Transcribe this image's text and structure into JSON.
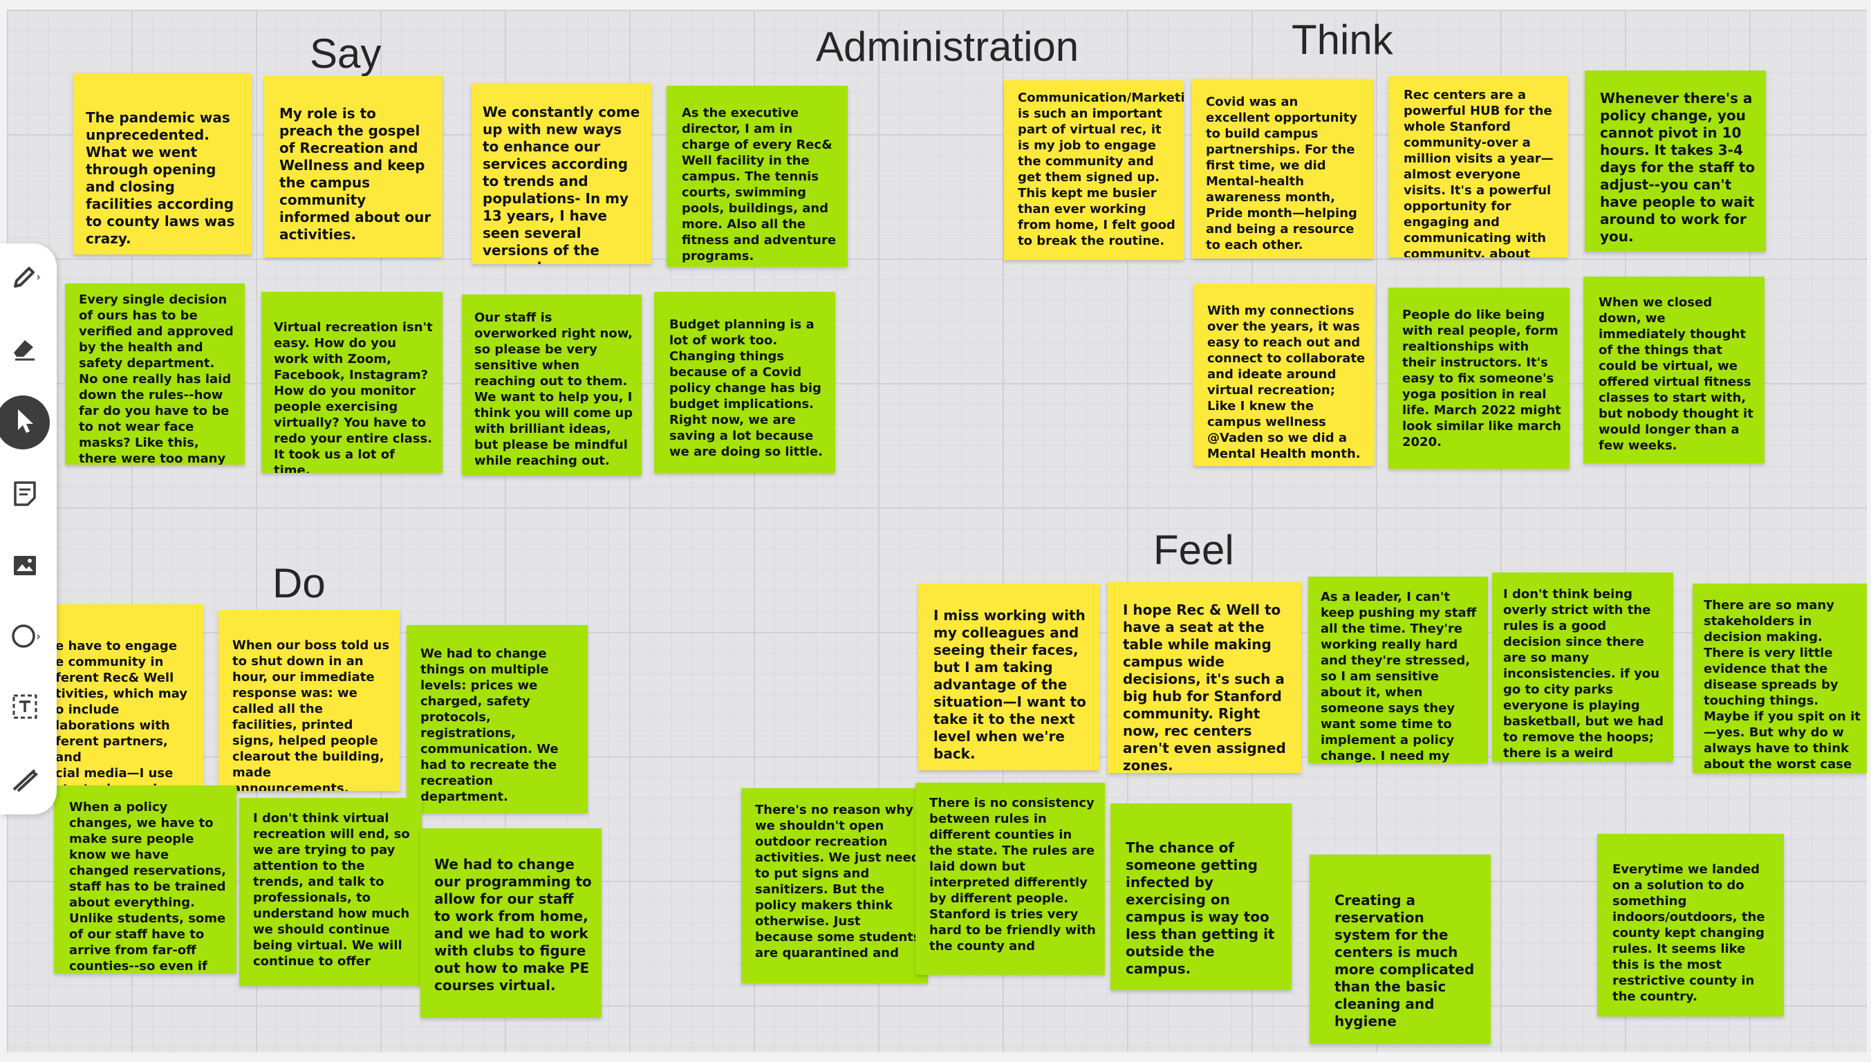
{
  "board": {
    "headings": {
      "say": "Say",
      "administration": "Administration",
      "think": "Think",
      "do": "Do",
      "feel": "Feel"
    },
    "notes": {
      "say_1": "The pandemic was unprecedented. What we went through opening and closing facilities according to county laws was crazy.",
      "say_2": "My role is to preach the gospel of Recreation and Wellness and keep the campus community informed about our activities.",
      "say_3": "We constantly come up with new ways to enhance our services according to trends and populations- In my 13 years, I have seen several versions of the same classes.",
      "say_4": "As the executive director, I am in charge of every Rec& Well facility in the campus. The tennis courts, swimming pools, buildings, and more. Also all the fitness and adventure programs.",
      "say_5": "Every single decision of ours has to be verified and approved by the health and safety department. No one really has laid down the rules--how far do you have to be to not wear face masks? Like this, there were too many",
      "say_6": "Virtual recreation isn't easy. How do you work with Zoom, Facebook, Instagram? How do you monitor people exercising virtually? You have to redo your entire class. It took us a lot of time.",
      "say_7": "Our staff is overworked right now, so please be very sensitive when reaching out to them. We want to help you, I think you will come up with brilliant ideas, but please be mindful while reaching out.",
      "say_8": "Budget planning is a lot of work too. Changing things because of a Covid policy change has big budget implications. Right now, we are saving a lot because we are doing so little.",
      "think_1": "Communication/Marketing is such an important part of virtual rec, it is my job to engage the community and get them signed up. This kept me  busier than ever working from home, I felt good to break the routine.",
      "think_2": "Covid was an excellent opportunity to build campus partnerships. For the first time, we did Mental-health awareness month, Pride month—helping and being a resource to each other.",
      "think_3": "Rec centers are a powerful HUB for the whole Stanford community-over a million visits a year—almost everyone visits. It's a powerful opportunity for engaging and communicating with community, about",
      "think_4": "Whenever there's a policy change, you cannot pivot in 10 hours. It takes 3-4 days for the staff to adjust--you can't have people to wait around to work for you.",
      "think_5": "With my connections over the years, it was easy to reach out and connect to collaborate and ideate around virtual recreation; Like I knew the campus wellness @Vaden  so we did a Mental Health month.",
      "think_6": "People do like being with real people, form realtionships with their instructors. It's easy to fix someone's yoga position in real life. March 2022 might look similar like march 2020.",
      "think_7": "When we closed down, we immediately thought of the things that could be virtual, we offered virtual fitness classes to start with, but nobody thought it would longer than a few weeks.",
      "do_1": "e have to engage\ne community in\nferent Rec& Well\ntivities, which may\no include\nlaborations with\nferent partners, and\ncial media—I use\n strategies and\nperience",
      "do_2": "When our boss told us to shut down in an hour, our immediate response was: we called all the facilities, printed signs, helped people clearout the building, made announcements.",
      "do_3": "We had to change things on multiple levels: prices we charged, safety protocols, registrations, communication. We had to recreate the recreation department.",
      "do_4": "When a policy changes, we have to make sure people know we have changed reservations, staff has to be trained about everything. Unlike students, some of our staff have to arrive from far-off counties--so even if",
      "do_5": "I don't think virtual recreation will end, so we are trying to pay attention to the trends, and talk to professionals, to understand how much we should continue being virtual. We will continue to offer",
      "do_6": "We had to change our programming to allow for our staff to work from home, and we had to work with clubs to figure out how to make PE courses virtual.",
      "feel_1": "I miss working with my colleagues and seeing their faces, but I am taking advantage of the situation—I want to take it to the next level when we're back.",
      "feel_2": "I hope Rec & Well to have a seat at the table while making campus wide decisions, it's such a big hub for Stanford community. Right now, rec centers aren't even assigned zones.",
      "feel_3": "As a leader, I can't keep pushing my staff all the time. They're working really hard and they're stressed, so I am sensitive about it, when someone says they want some time to implement a policy change. I need my",
      "feel_4": "I don't think being overly strict with the rules is a good decision since there are so many inconsistencies. if you go to city parks everyone is playing basketball, but we had to remove the hoops; there is a weird",
      "feel_5": "There are so many stakeholders in decision making. There is very little evidence that the disease spreads by touching things. Maybe if you spit on it—yes. But why do w always have to think about the worst case",
      "feel_6": "There's no reason why we shouldn't open outdoor recreation activities. We just need to put signs and sanitizers. But the policy makers think otherwise. Just because some students are quarantined and",
      "feel_7": "There is no consistency between rules in different counties in the state. The rules are laid down but interpreted differently by different people. Stanford is tries very hard to be friendly with the county and",
      "feel_8": "The chance of someone getting infected by exercising on campus is way too less than getting it outside the campus.",
      "feel_9": "Creating a reservation system for the centers is much more complicated than the basic cleaning and hygiene",
      "feel_10": "Everytime we landed on a solution to do something indoors/outdoors, the county kept changing rules. It seems like this is the most restrictive county in the country."
    }
  },
  "toolbar": {
    "tools": [
      {
        "icon": "pen-icon",
        "active": false
      },
      {
        "icon": "eraser-icon",
        "active": false
      },
      {
        "icon": "cursor-icon",
        "active": true
      },
      {
        "icon": "sticky-note-icon",
        "active": false
      },
      {
        "icon": "image-icon",
        "active": false
      },
      {
        "icon": "circle-shape-icon",
        "active": false
      },
      {
        "icon": "text-box-icon",
        "active": false
      },
      {
        "icon": "connector-icon",
        "active": false
      }
    ]
  },
  "colors": {
    "yellow_note": "#fde93b",
    "green_note": "#a4e20a",
    "board_background": "#e4e4e6",
    "active_tool": "#3d3d3d"
  }
}
